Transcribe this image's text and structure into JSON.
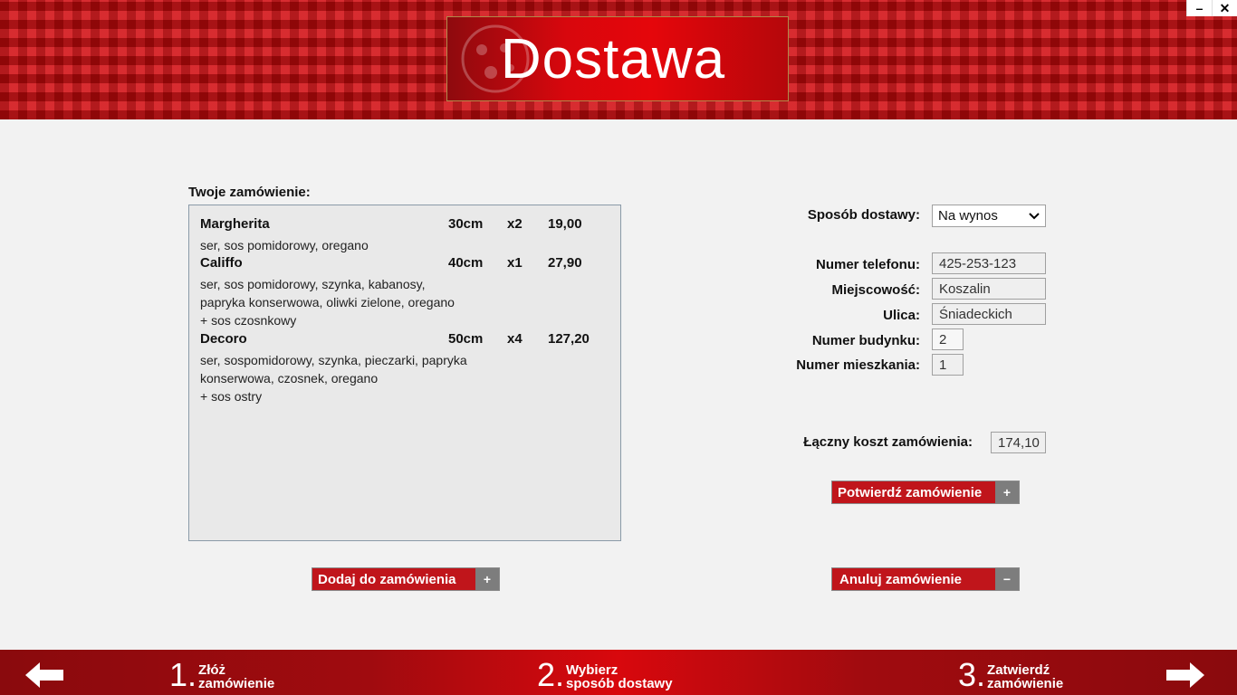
{
  "window": {
    "title": "Dostawa",
    "minimize": "–",
    "close": "✕"
  },
  "order": {
    "label": "Twoje zamówienie:",
    "items": [
      {
        "name": "Margherita",
        "size": "30cm",
        "qty": "x2",
        "price": "19,00",
        "desc": "ser, sos pomidorowy, oregano",
        "extra": ""
      },
      {
        "name": "Califfo",
        "size": "40cm",
        "qty": "x1",
        "price": "27,90",
        "desc": "ser, sos pomidorowy, szynka, kabanosy, papryka konserwowa, oliwki zielone, oregano",
        "extra": "+ sos czosnkowy"
      },
      {
        "name": "Decoro",
        "size": "50cm",
        "qty": "x4",
        "price": "127,20",
        "desc": "ser, sospomidorowy, szynka, pieczarki, papryka konserwowa, czosnek, oregano",
        "extra": "+ sos ostry"
      }
    ]
  },
  "buttons": {
    "add": {
      "label": "Dodaj do zamówienia",
      "symbol": "+"
    },
    "confirm": {
      "label": "Potwierdź zamówienie",
      "symbol": "+"
    },
    "cancel": {
      "label": "Anuluj zamówienie",
      "symbol": "−"
    }
  },
  "form": {
    "delivery_label": "Sposób dostawy:",
    "delivery_value": "Na wynos",
    "phone_label": "Numer telefonu:",
    "phone_value": "425-253-123",
    "city_label": "Miejscowość:",
    "city_value": "Koszalin",
    "street_label": "Ulica:",
    "street_value": "Śniadeckich",
    "building_label": "Numer budynku:",
    "building_value": "2",
    "apartment_label": "Numer mieszkania:",
    "apartment_value": "1",
    "total_label": "Łączny koszt zamówienia:",
    "total_value": "174,10"
  },
  "footer": {
    "steps": [
      {
        "num": "1.",
        "line1": "Złóż",
        "line2": "zamówienie"
      },
      {
        "num": "2.",
        "line1": "Wybierz",
        "line2": "sposób dostawy"
      },
      {
        "num": "3.",
        "line1": "Zatwierdź",
        "line2": "zamówienie"
      }
    ]
  },
  "colors": {
    "accent": "#c0151b",
    "header": "#c4161c",
    "button_symbol": "#7d7d7d"
  }
}
